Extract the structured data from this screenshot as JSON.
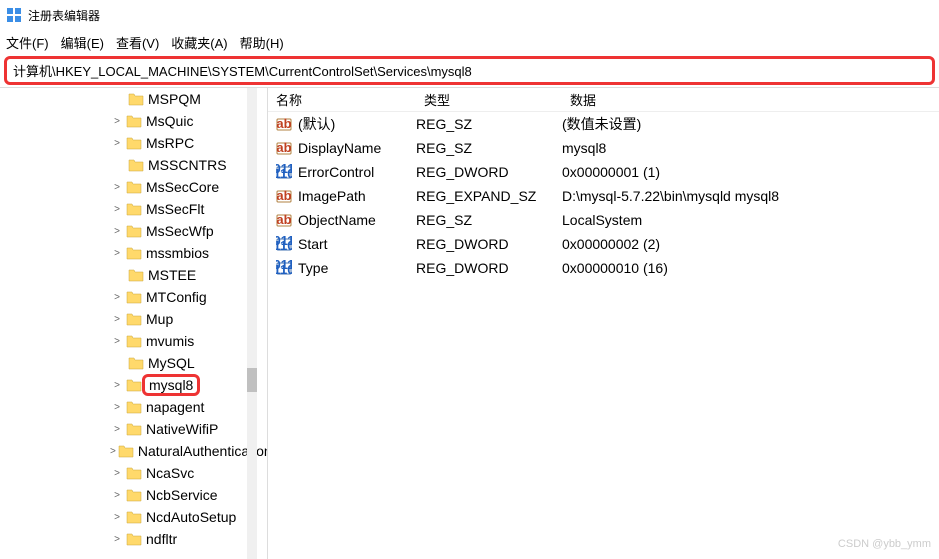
{
  "window": {
    "title": "注册表编辑器"
  },
  "menu": {
    "file": "文件(F)",
    "edit": "编辑(E)",
    "view": "查看(V)",
    "favorites": "收藏夹(A)",
    "help": "帮助(H)"
  },
  "address": "计算机\\HKEY_LOCAL_MACHINE\\SYSTEM\\CurrentControlSet\\Services\\mysql8",
  "tree": [
    {
      "label": "MSPQM",
      "exp": false
    },
    {
      "label": "MsQuic",
      "exp": true
    },
    {
      "label": "MsRPC",
      "exp": true
    },
    {
      "label": "MSSCNTRS",
      "exp": false
    },
    {
      "label": "MsSecCore",
      "exp": true
    },
    {
      "label": "MsSecFlt",
      "exp": true
    },
    {
      "label": "MsSecWfp",
      "exp": true
    },
    {
      "label": "mssmbios",
      "exp": true
    },
    {
      "label": "MSTEE",
      "exp": false
    },
    {
      "label": "MTConfig",
      "exp": true
    },
    {
      "label": "Mup",
      "exp": true
    },
    {
      "label": "mvumis",
      "exp": true
    },
    {
      "label": "MySQL",
      "exp": false
    },
    {
      "label": "mysql8",
      "exp": true,
      "selected": true
    },
    {
      "label": "napagent",
      "exp": true
    },
    {
      "label": "NativeWifiP",
      "exp": true
    },
    {
      "label": "NaturalAuthentication",
      "exp": true
    },
    {
      "label": "NcaSvc",
      "exp": true
    },
    {
      "label": "NcbService",
      "exp": true
    },
    {
      "label": "NcdAutoSetup",
      "exp": true
    },
    {
      "label": "ndfltr",
      "exp": true
    }
  ],
  "columns": {
    "name": "名称",
    "type": "类型",
    "data": "数据"
  },
  "values": [
    {
      "icon": "str",
      "name": "(默认)",
      "type": "REG_SZ",
      "data": "(数值未设置)"
    },
    {
      "icon": "str",
      "name": "DisplayName",
      "type": "REG_SZ",
      "data": "mysql8"
    },
    {
      "icon": "bin",
      "name": "ErrorControl",
      "type": "REG_DWORD",
      "data": "0x00000001 (1)"
    },
    {
      "icon": "str",
      "name": "ImagePath",
      "type": "REG_EXPAND_SZ",
      "data": "D:\\mysql-5.7.22\\bin\\mysqld mysql8"
    },
    {
      "icon": "str",
      "name": "ObjectName",
      "type": "REG_SZ",
      "data": "LocalSystem"
    },
    {
      "icon": "bin",
      "name": "Start",
      "type": "REG_DWORD",
      "data": "0x00000002 (2)"
    },
    {
      "icon": "bin",
      "name": "Type",
      "type": "REG_DWORD",
      "data": "0x00000010 (16)"
    }
  ],
  "watermark": "CSDN @ybb_ymm"
}
